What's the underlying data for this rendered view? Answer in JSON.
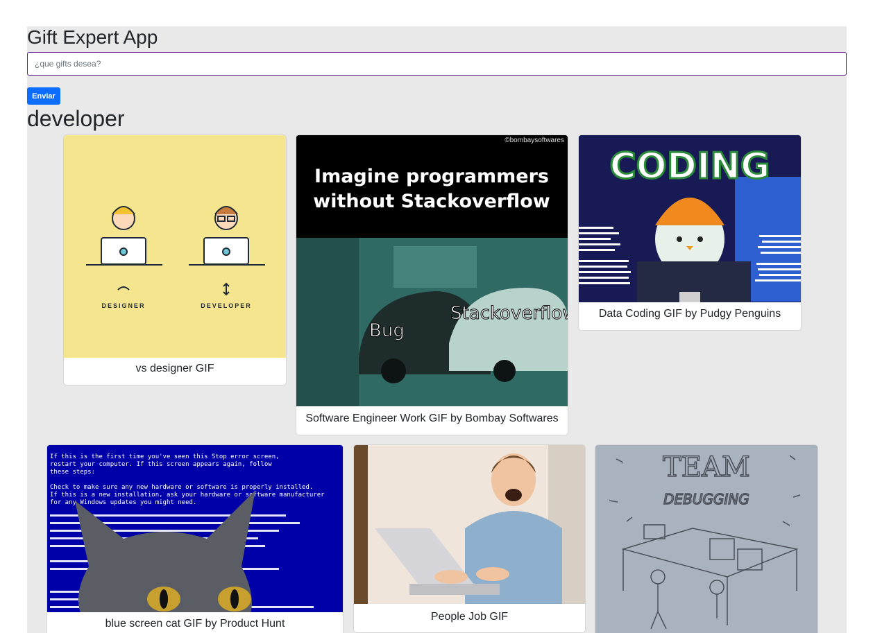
{
  "app": {
    "title": "Gift Expert App"
  },
  "search": {
    "placeholder": "¿que gifts desea?",
    "value": ""
  },
  "submit_button": {
    "label": "Enviar"
  },
  "category": {
    "title": "developer"
  },
  "gifs": [
    {
      "title": "vs designer GIF",
      "image_text": [
        "DESIGNER",
        "DEVELOPER"
      ]
    },
    {
      "title": "Software Engineer Work GIF by Bombay Softwares",
      "image_text": [
        "©bombaysoftwares",
        "Imagine programmers",
        "without Stackoverflow",
        "Stackoverflow",
        "Bug"
      ]
    },
    {
      "title": "Data Coding GIF by Pudgy Penguins",
      "image_text": [
        "CODING"
      ]
    },
    {
      "title": "blue screen cat GIF by Product Hunt",
      "image_text": [
        "If this is the first time you've seen this Stop error screen,",
        "restart your computer. If this screen appears again, follow",
        "these steps:",
        "Check to make sure any new hardware or software is properly installed.",
        "If this is a new installation, ask your hardware or software manufacturer",
        "for any Windows updates you might need."
      ]
    },
    {
      "title": "People Job GIF",
      "image_text": []
    },
    {
      "title": "",
      "image_text": [
        "TEAM",
        "DEBUGGING"
      ]
    }
  ],
  "colors": {
    "accent_button": "#0d6efd",
    "input_border": "#6a1b9a",
    "background": "#e9e9e9"
  }
}
